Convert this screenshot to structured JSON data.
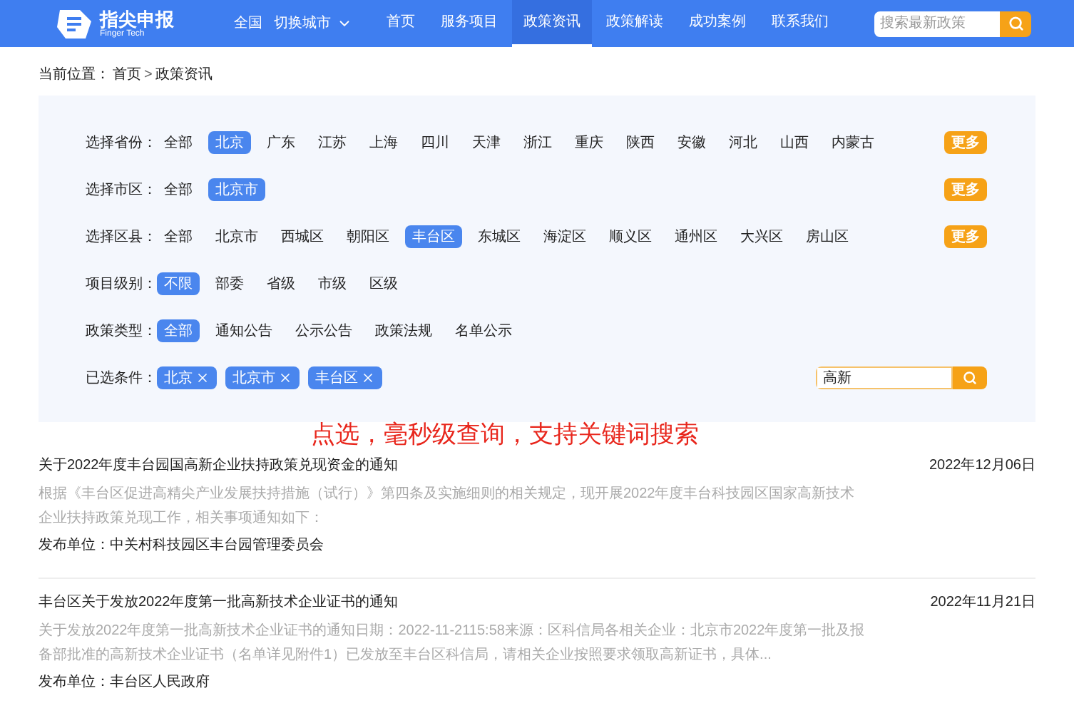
{
  "header": {
    "brand": "指尖申报",
    "brand_sub": "Finger Tech",
    "region": "全国",
    "switch_city": "切换城市",
    "nav": [
      {
        "label": "首页",
        "selected": false
      },
      {
        "label": "服务项目",
        "selected": false
      },
      {
        "label": "政策资讯",
        "selected": true
      },
      {
        "label": "政策解读",
        "selected": false
      },
      {
        "label": "成功案例",
        "selected": false
      },
      {
        "label": "联系我们",
        "selected": false
      }
    ],
    "search": {
      "placeholder": "搜索最新政策"
    }
  },
  "breadcrumb": {
    "label": "当前位置：",
    "separator": ">",
    "items": [
      "首页",
      "政策资讯"
    ]
  },
  "filters": [
    {
      "label": "选择省份：",
      "options": [
        {
          "label": "全部",
          "selected": false
        },
        {
          "label": "北京",
          "selected": true
        },
        {
          "label": "广东",
          "selected": false
        },
        {
          "label": "江苏",
          "selected": false
        },
        {
          "label": "上海",
          "selected": false
        },
        {
          "label": "四川",
          "selected": false
        },
        {
          "label": "天津",
          "selected": false
        },
        {
          "label": "浙江",
          "selected": false
        },
        {
          "label": "重庆",
          "selected": false
        },
        {
          "label": "陕西",
          "selected": false
        },
        {
          "label": "安徽",
          "selected": false
        },
        {
          "label": "河北",
          "selected": false
        },
        {
          "label": "山西",
          "selected": false
        },
        {
          "label": "内蒙古",
          "selected": false
        }
      ],
      "more": "更多"
    },
    {
      "label": "选择市区：",
      "options": [
        {
          "label": "全部",
          "selected": false
        },
        {
          "label": "北京市",
          "selected": true
        }
      ],
      "more": "更多"
    },
    {
      "label": "选择区县：",
      "options": [
        {
          "label": "全部",
          "selected": false
        },
        {
          "label": "北京市",
          "selected": false
        },
        {
          "label": "西城区",
          "selected": false
        },
        {
          "label": "朝阳区",
          "selected": false
        },
        {
          "label": "丰台区",
          "selected": true
        },
        {
          "label": "东城区",
          "selected": false
        },
        {
          "label": "海淀区",
          "selected": false
        },
        {
          "label": "顺义区",
          "selected": false
        },
        {
          "label": "通州区",
          "selected": false
        },
        {
          "label": "大兴区",
          "selected": false
        },
        {
          "label": "房山区",
          "selected": false
        }
      ],
      "more": "更多"
    },
    {
      "label": "项目级别：",
      "options": [
        {
          "label": "不限",
          "selected": true
        },
        {
          "label": "部委",
          "selected": false
        },
        {
          "label": "省级",
          "selected": false
        },
        {
          "label": "市级",
          "selected": false
        },
        {
          "label": "区级",
          "selected": false
        }
      ]
    },
    {
      "label": "政策类型：",
      "options": [
        {
          "label": "全部",
          "selected": true
        },
        {
          "label": "通知公告",
          "selected": false
        },
        {
          "label": "公示公告",
          "selected": false
        },
        {
          "label": "政策法规",
          "selected": false
        },
        {
          "label": "名单公示",
          "selected": false
        }
      ]
    }
  ],
  "selected_conditions": {
    "label": "已选条件：",
    "tags": [
      "北京",
      "北京市",
      "丰台区"
    ],
    "keyword": "高新"
  },
  "annotation": "点选，毫秒级查询，支持关键词搜索",
  "articles": [
    {
      "title": "关于2022年度丰台园国高新企业扶持政策兑现资金的通知",
      "date": "2022年12月06日",
      "summary": "根据《丰台区促进高精尖产业发展扶持措施（试行）》第四条及实施细则的相关规定，现开展2022年度丰台科技园区国家高新技术企业扶持政策兑现工作，相关事项通知如下：",
      "publisher": "发布单位：中关村科技园区丰台园管理委员会"
    },
    {
      "title": "丰台区关于发放2022年度第一批高新技术企业证书的通知",
      "date": "2022年11月21日",
      "summary": "关于发放2022年度第一批高新技术企业证书的通知日期：2022-11-2115:58来源：区科信局各相关企业：北京市2022年度第一批及报备部批准的高新技术企业证书（名单详见附件1）已发放至丰台区科信局，请相关企业按照要求领取高新证书，具体...",
      "publisher": "发布单位：丰台区人民政府"
    }
  ]
}
